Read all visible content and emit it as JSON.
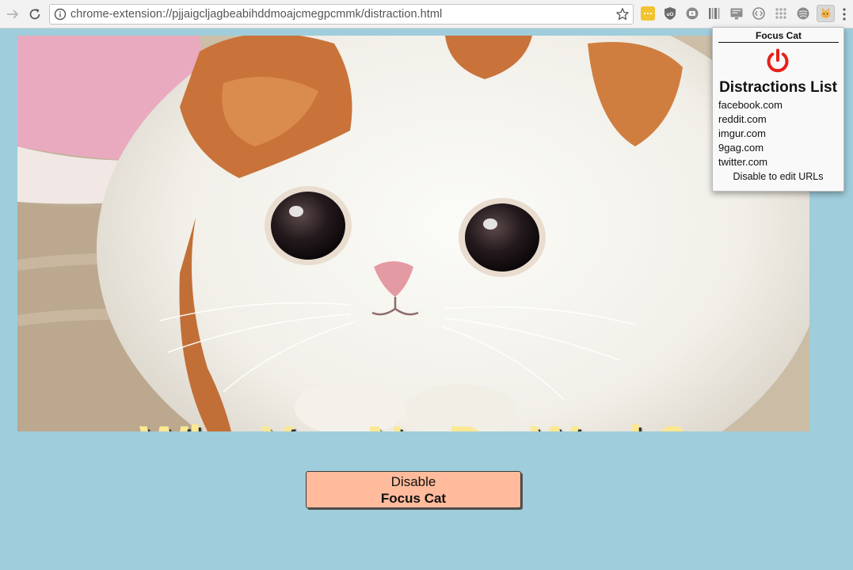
{
  "browser": {
    "url": "chrome-extension://pjjaigcljagbeabihddmoajcmegpcmmk/distraction.html"
  },
  "icons": {
    "forward": "arrow-forward-icon",
    "reload": "reload-icon",
    "info": "info-icon",
    "bookmark": "star-icon",
    "menu": "more-vertical-icon",
    "power": "power-icon"
  },
  "colors": {
    "page_background": "#9fcddb",
    "caption": "#fbe892",
    "button_background": "#ffbb9b",
    "power_icon": "#e8201a"
  },
  "hero": {
    "caption": "Why You No Do Work?"
  },
  "disable_button": {
    "line1": "Disable",
    "line2": "Focus Cat"
  },
  "popup": {
    "title": "Focus Cat",
    "heading": "Distractions List",
    "sites": [
      "facebook.com",
      "reddit.com",
      "imgur.com",
      "9gag.com",
      "twitter.com"
    ],
    "note": "Disable to edit URLs"
  }
}
